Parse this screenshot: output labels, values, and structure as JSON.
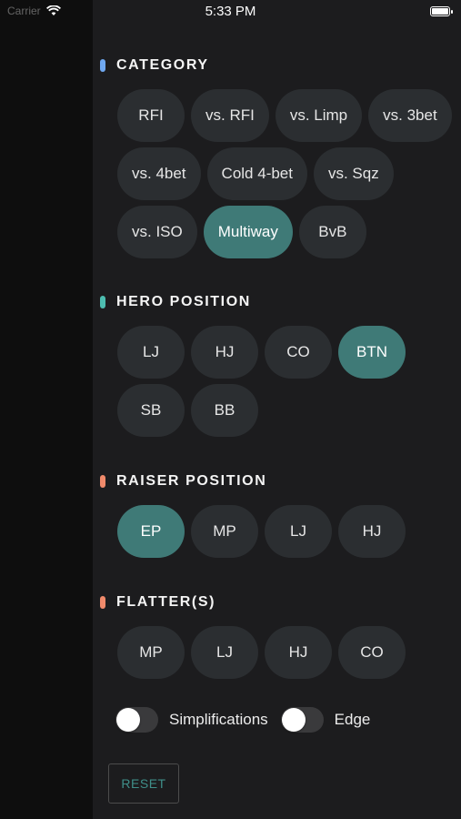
{
  "status_bar": {
    "carrier": "Carrier",
    "time": "5:33 PM"
  },
  "colors": {
    "accent_category": "#6fa8f0",
    "accent_hero": "#4dbdb0",
    "accent_raiser": "#f08a6b",
    "accent_flatter": "#f08a6b",
    "chip_active": "#3f7a77",
    "chip_inactive": "#2b2e31"
  },
  "sections": {
    "category": {
      "title": "CATEGORY",
      "options": [
        "RFI",
        "vs. RFI",
        "vs. Limp",
        "vs. 3bet",
        "vs. 4bet",
        "Cold 4-bet",
        "vs. Sqz",
        "vs. ISO",
        "Multiway",
        "BvB"
      ],
      "selected": "Multiway"
    },
    "hero_position": {
      "title": "HERO POSITION",
      "options": [
        "LJ",
        "HJ",
        "CO",
        "BTN",
        "SB",
        "BB"
      ],
      "selected": "BTN"
    },
    "raiser_position": {
      "title": "RAISER POSITION",
      "options": [
        "EP",
        "MP",
        "LJ",
        "HJ"
      ],
      "selected": "EP"
    },
    "flatters": {
      "title": "FLATTER(S)",
      "options": [
        "MP",
        "LJ",
        "HJ",
        "CO"
      ],
      "selected": null
    }
  },
  "toggles": {
    "simplifications": {
      "label": "Simplifications",
      "on": false
    },
    "edge": {
      "label": "Edge",
      "on": false
    }
  },
  "reset_label": "RESET"
}
